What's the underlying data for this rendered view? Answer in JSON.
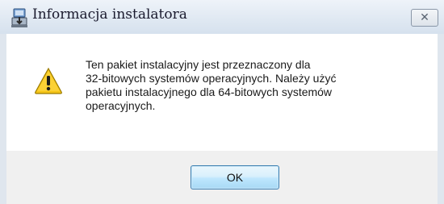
{
  "window": {
    "title": "Informacja instalatora",
    "app_icon": "installer-icon",
    "close_icon": "close-x-icon",
    "close_glyph": "✕"
  },
  "dialog": {
    "icon": "warning-triangle-icon",
    "message_lines": [
      "Ten pakiet instalacyjny jest przeznaczony dla",
      "32-bitowych systemów operacyjnych. Należy użyć",
      "pakietu instalacyjnego dla 64-bitowych systemów",
      "operacyjnych."
    ],
    "ok_label": "OK"
  },
  "colors": {
    "titlebar": "#dfe8f2",
    "dialog_background": "#ffffff",
    "button_band": "#f0f0f0",
    "warning_fill": "#f5c518",
    "ok_border": "#3c7fb1"
  }
}
